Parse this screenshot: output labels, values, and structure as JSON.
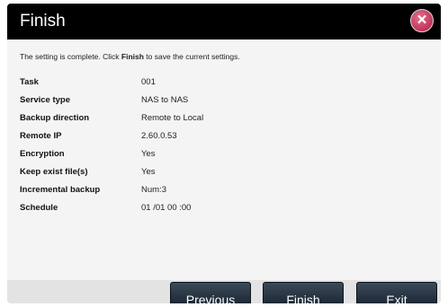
{
  "dialog": {
    "title": "Finish",
    "intro_before": "The setting is complete. Click ",
    "intro_bold": "Finish",
    "intro_after": " to save the current settings."
  },
  "rows": [
    {
      "label": "Task",
      "value": "001"
    },
    {
      "label": "Service type",
      "value": "NAS to NAS"
    },
    {
      "label": "Backup direction",
      "value": "Remote to Local"
    },
    {
      "label": "Remote IP",
      "value": "2.60.0.53"
    },
    {
      "label": "Encryption",
      "value": "Yes"
    },
    {
      "label": "Keep exist file(s)",
      "value": "Yes"
    },
    {
      "label": "Incremental backup",
      "value": "Num:3"
    },
    {
      "label": "Schedule",
      "value": "01 /01 00 :00"
    }
  ],
  "buttons": {
    "previous": "Previous",
    "finish": "Finish",
    "exit": "Exit"
  },
  "icons": {
    "close": "close-icon"
  },
  "colors": {
    "titlebar": "#000000",
    "close": "#c0204f",
    "button": "#26323f"
  }
}
